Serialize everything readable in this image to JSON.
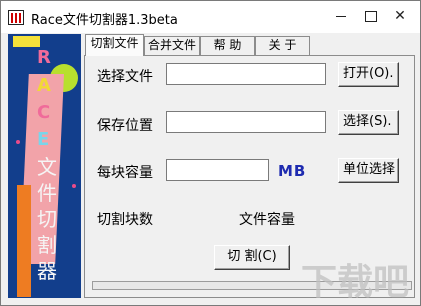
{
  "window": {
    "title": "Race文件切割器1.3beta",
    "controls": {
      "minimize_icon": "minimize-icon",
      "maximize_icon": "maximize-icon",
      "close_symbol": "✕"
    }
  },
  "banner": {
    "letters": [
      "R",
      "A",
      "C",
      "E"
    ],
    "vertical_text": [
      "文",
      "件",
      "切",
      "割",
      "器"
    ],
    "colors": {
      "background": "#123e8c",
      "wedge": "#f2a3a9",
      "circle": "#b8df2e",
      "bar": "#ee7c22",
      "square": "#f4e13a"
    }
  },
  "tabs": [
    {
      "label": "切割文件",
      "active": true
    },
    {
      "label": "合并文件",
      "active": false
    },
    {
      "label": "帮  助",
      "active": false
    },
    {
      "label": "关  于",
      "active": false
    }
  ],
  "form": {
    "source_label": "选择文件",
    "source_value": "",
    "open_button": "打开(O).",
    "dest_label": "保存位置",
    "dest_value": "",
    "select_button": "选择(S).",
    "chunk_label": "每块容量",
    "chunk_value": "",
    "chunk_unit": "MB",
    "unit_button": "单位选择",
    "count_label": "切割块数",
    "size_label": "文件容量",
    "cut_button": "切  割(C)"
  },
  "progress": {
    "value": 0
  },
  "watermark": "下载吧"
}
